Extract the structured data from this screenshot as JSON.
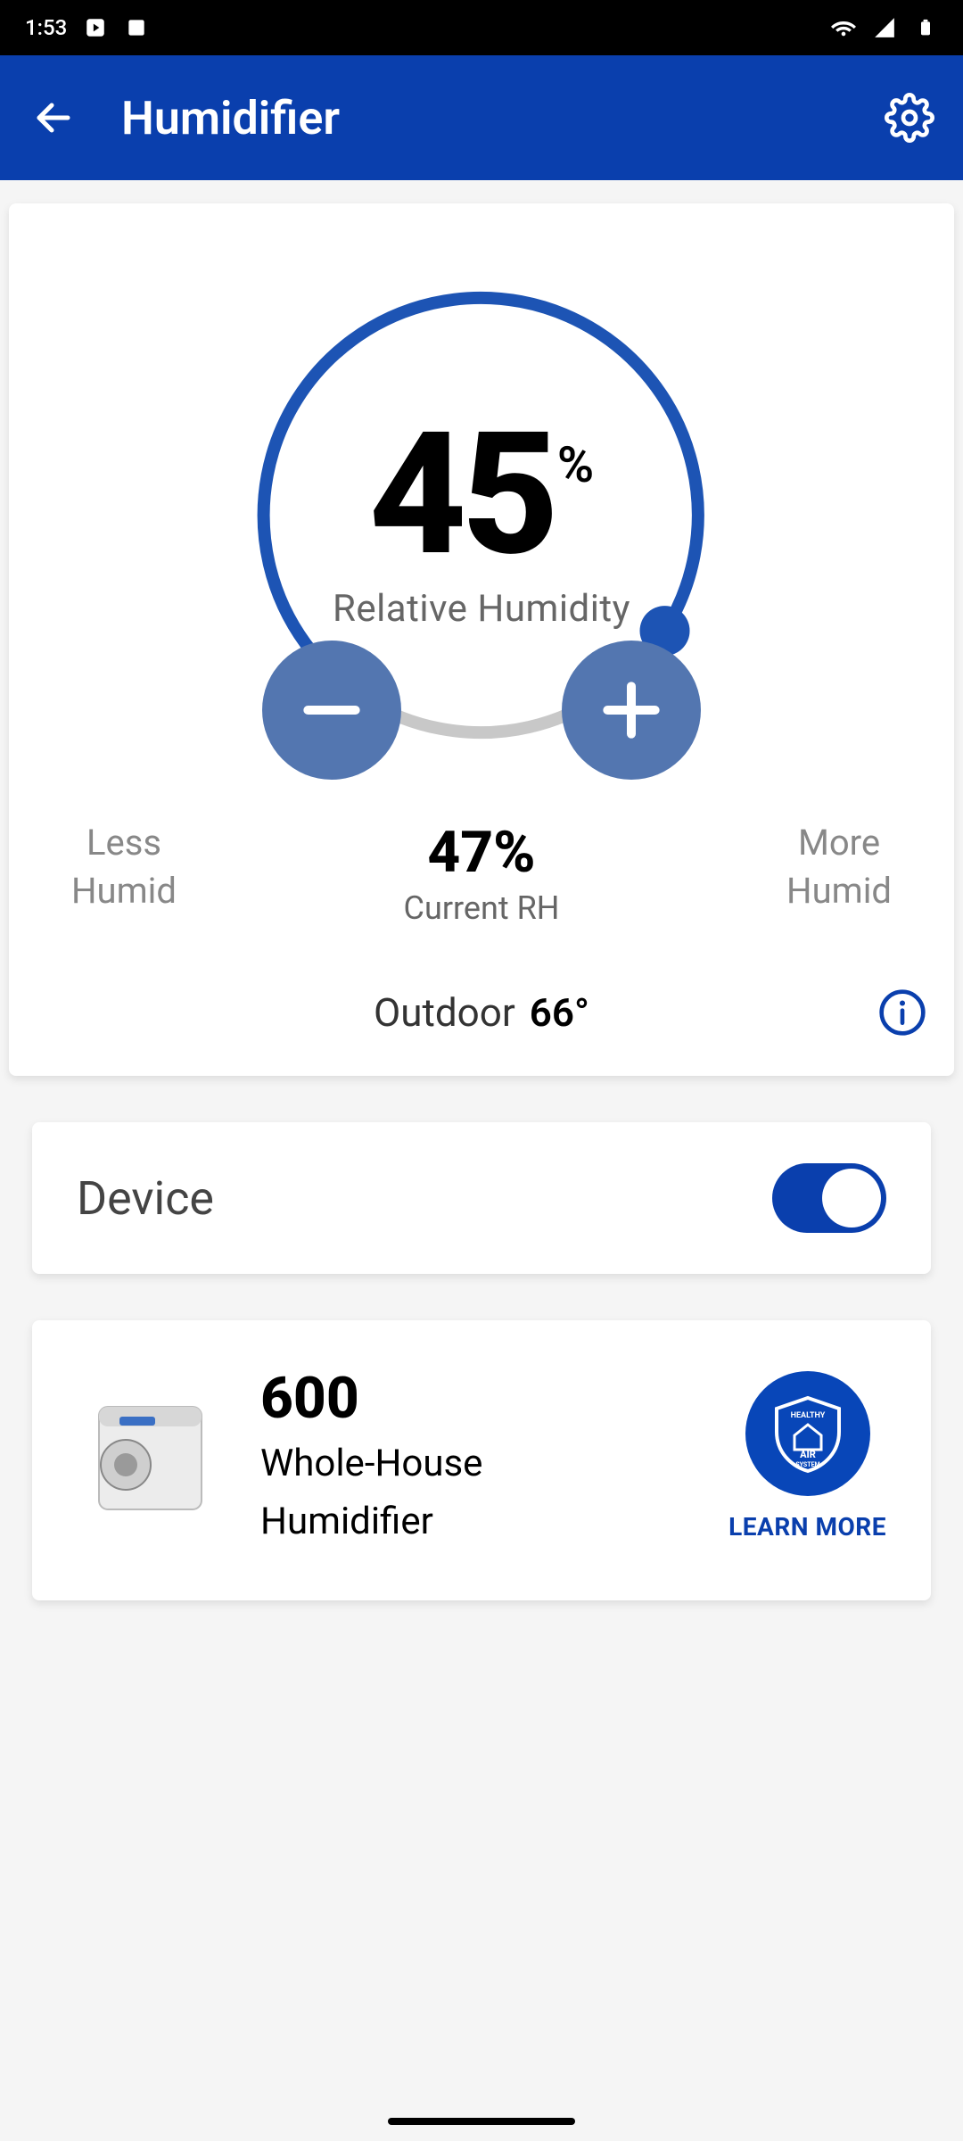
{
  "status": {
    "time": "1:53",
    "signal_icon": "signal-icon",
    "wifi_icon": "wifi-icon",
    "battery_icon": "battery-icon"
  },
  "header": {
    "title": "Humidifier"
  },
  "dial": {
    "target_value": "45",
    "percent_sign": "%",
    "label": "Relative Humidity"
  },
  "triple": {
    "less_line1": "Less",
    "less_line2": "Humid",
    "current_value": "47%",
    "current_label": "Current RH",
    "more_line1": "More",
    "more_line2": "Humid"
  },
  "outdoor": {
    "label": "Outdoor",
    "value": "66°"
  },
  "device": {
    "label": "Device",
    "enabled": true
  },
  "product": {
    "model": "600",
    "desc_line1": "Whole-House",
    "desc_line2": "Humidifier",
    "badge_line1": "HEALTHY",
    "badge_line2": "AIR",
    "badge_line3": "SYSTEM",
    "learn_more": "LEARN MORE"
  },
  "colors": {
    "brand_blue": "#0a3fad",
    "round_btn_blue": "#5376b0",
    "badge_blue": "#0846b8"
  }
}
